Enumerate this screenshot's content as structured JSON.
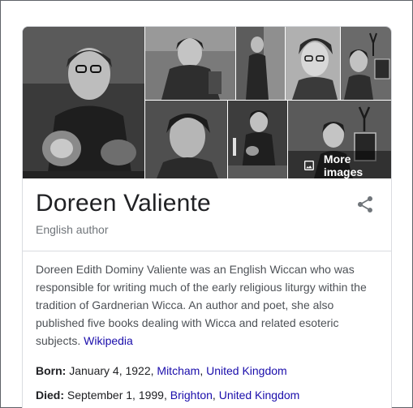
{
  "gallery": {
    "more_images_label": "More images"
  },
  "entity": {
    "name": "Doreen Valiente",
    "type": "English author",
    "description": "Doreen Edith Dominy Valiente was an English Wiccan who was responsible for writing much of the early religious liturgy within the tradition of Gardnerian Wicca. An author and poet, she also published five books dealing with Wicca and related esoteric subjects.",
    "source_link": "Wikipedia"
  },
  "facts": {
    "born": {
      "label": "Born:",
      "date": "January 4, 1922,",
      "place": "Mitcham",
      "sep": ",",
      "country": "United Kingdom"
    },
    "died": {
      "label": "Died:",
      "date": "September 1, 1999,",
      "place": "Brighton",
      "sep": ",",
      "country": "United Kingdom"
    }
  },
  "colors": {
    "link": "#1a0dab",
    "title": "#202124",
    "muted": "#70757a",
    "border": "#dadce0"
  },
  "icons": {
    "share": "share-icon",
    "image": "image-icon"
  }
}
